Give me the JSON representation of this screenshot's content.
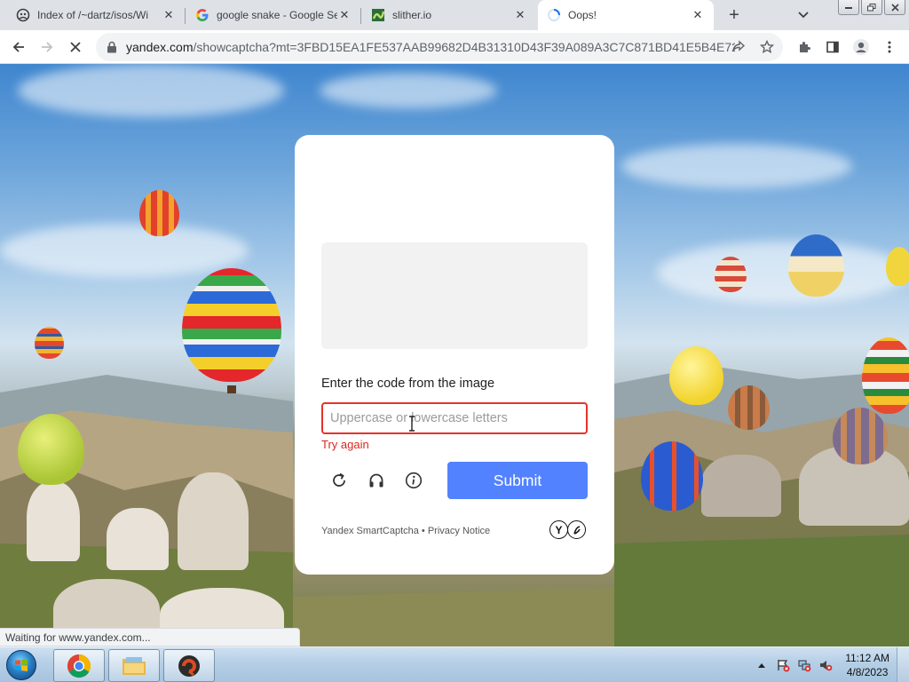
{
  "browser": {
    "tabs": [
      {
        "title": "Index of /~dartz/isos/Wi",
        "icon": "site-icon",
        "active": false
      },
      {
        "title": "google snake - Google Se",
        "icon": "google-icon",
        "active": false
      },
      {
        "title": "slither.io",
        "icon": "slither-icon",
        "active": false
      },
      {
        "title": "Oops!",
        "icon": "loading-spinner-icon",
        "active": true
      }
    ],
    "new_tab_label": "+",
    "url_host": "yandex.com",
    "url_path": "/showcaptcha?mt=3FBD15EA1FE537AAB99682D4B31310D43F39A089A3C7C871BD41E5B4E725...",
    "status_text": "Waiting for www.yandex.com..."
  },
  "captcha": {
    "label": "Enter the code from the image",
    "input_placeholder": "Uppercase or lowercase letters",
    "input_value": "",
    "error_text": "Try again",
    "submit_label": "Submit",
    "footer_brand": "Yandex SmartCaptcha",
    "footer_separator": " • ",
    "footer_privacy": "Privacy Notice",
    "icons": [
      "refresh-icon",
      "headphones-icon",
      "info-icon"
    ],
    "accent_color": "#5282ff",
    "error_color": "#d9281e"
  },
  "taskbar": {
    "apps": [
      "chrome-icon",
      "file-explorer-icon",
      "app-icon"
    ],
    "time": "11:12 AM",
    "date": "4/8/2023"
  }
}
